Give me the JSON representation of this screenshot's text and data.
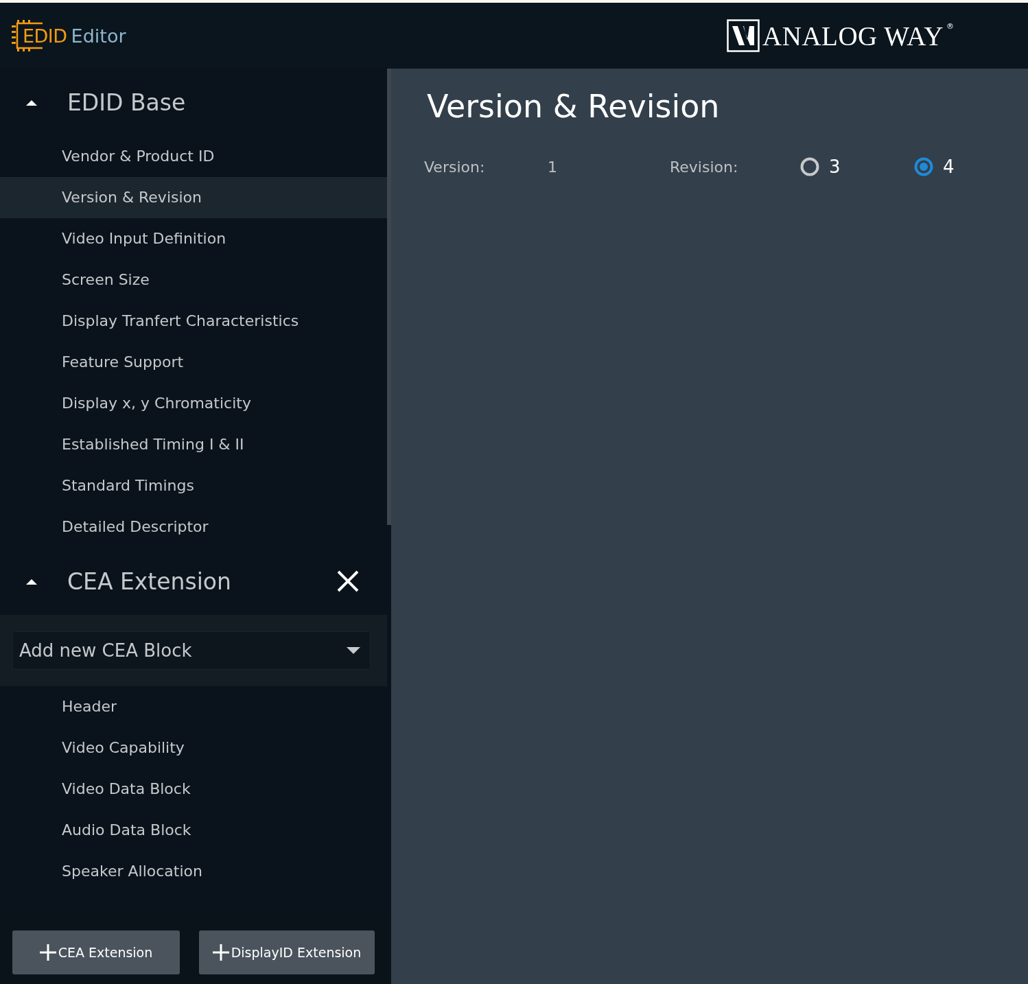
{
  "header": {
    "logo_accent": "EDID",
    "logo_text": "Editor",
    "brand": "ANALOG WAY",
    "brand_mark": "®"
  },
  "sidebar": {
    "sections": [
      {
        "title": "EDID Base",
        "expanded": true,
        "removable": false,
        "items": [
          {
            "label": "Vendor & Product ID",
            "selected": false
          },
          {
            "label": "Version & Revision",
            "selected": true
          },
          {
            "label": "Video Input Definition",
            "selected": false
          },
          {
            "label": "Screen Size",
            "selected": false
          },
          {
            "label": "Display Tranfert Characteristics",
            "selected": false
          },
          {
            "label": "Feature Support",
            "selected": false
          },
          {
            "label": "Display x, y Chromaticity",
            "selected": false
          },
          {
            "label": "Established Timing I & II",
            "selected": false
          },
          {
            "label": "Standard Timings",
            "selected": false
          },
          {
            "label": "Detailed Descriptor",
            "selected": false
          }
        ]
      },
      {
        "title": "CEA Extension",
        "expanded": true,
        "removable": true,
        "dropdown": {
          "value": "Add new CEA Block"
        },
        "items": [
          {
            "label": "Header",
            "selected": false
          },
          {
            "label": "Video Capability",
            "selected": false
          },
          {
            "label": "Video Data Block",
            "selected": false
          },
          {
            "label": "Audio Data Block",
            "selected": false
          },
          {
            "label": "Speaker Allocation",
            "selected": false
          }
        ]
      }
    ],
    "buttons": [
      "CEA Extension",
      "DisplayID Extension"
    ]
  },
  "main": {
    "title": "Version & Revision",
    "version_label": "Version:",
    "version_value": "1",
    "revision_label": "Revision:",
    "revision_options": [
      {
        "label": "3",
        "selected": false
      },
      {
        "label": "4",
        "selected": true
      }
    ]
  }
}
